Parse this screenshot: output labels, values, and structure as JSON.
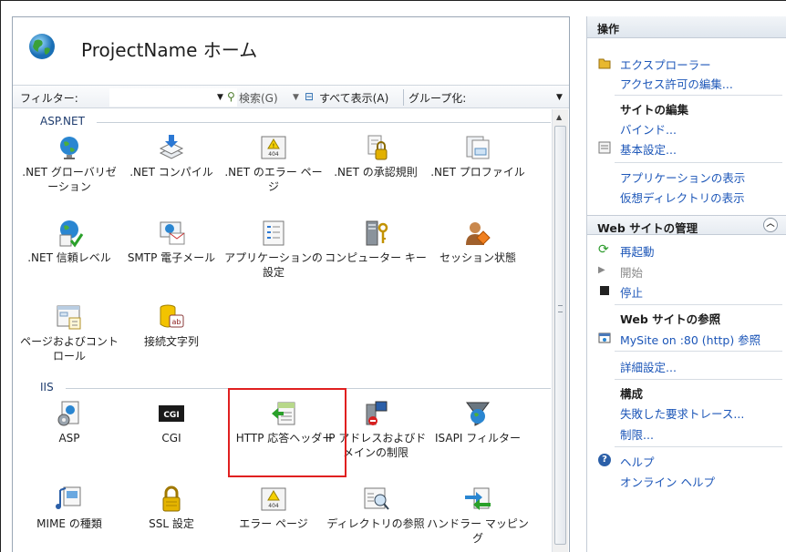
{
  "page": {
    "title": "ProjectName ホーム"
  },
  "toolbar": {
    "filter_label": "フィルター:",
    "filter_value": "",
    "search_label": "検索(G)",
    "show_all_label": "すべて表示(A)",
    "group_by_label": "グループ化:"
  },
  "groups": {
    "aspnet": "ASP.NET",
    "iis": "IIS"
  },
  "features": {
    "net_globalization": ".NET グローバリゼーション",
    "net_compilation": ".NET コンパイル",
    "net_error_pages": ".NET のエラー ページ",
    "net_authorization": ".NET の承認規則",
    "net_profile": ".NET プロファイル",
    "net_trust_level": ".NET 信頼レベル",
    "smtp_email": "SMTP 電子メール",
    "app_settings": "アプリケーションの設定",
    "machine_key": "コンピューター キー",
    "session_state": "セッション状態",
    "pages_controls": "ページおよびコントロール",
    "connection_strings": "接続文字列",
    "asp": "ASP",
    "cgi": "CGI",
    "http_response_headers": "HTTP 応答ヘッダー",
    "ip_domain_restrictions": "IP アドレスおよびドメインの制限",
    "isapi_filters": "ISAPI フィルター",
    "mime_types": "MIME の種類",
    "ssl_settings": "SSL 設定",
    "error_pages": "エラー ページ",
    "directory_browsing": "ディレクトリの参照",
    "handler_mappings": "ハンドラー マッピング"
  },
  "icon_text": {
    "cgi": "CGI",
    "error_code": "404"
  },
  "actions": {
    "title": "操作",
    "explore": "エクスプローラー",
    "edit_permissions": "アクセス許可の編集...",
    "edit_site_header": "サイトの編集",
    "bindings": "バインド...",
    "basic_settings": "基本設定...",
    "view_applications": "アプリケーションの表示",
    "view_virtual_dirs": "仮想ディレクトリの表示",
    "manage_website_header": "Web サイトの管理",
    "restart": "再起動",
    "start": "開始",
    "stop": "停止",
    "browse_website_header": "Web サイトの参照",
    "browse_link": "MySite on :80 (http) 参照",
    "advanced_settings": "詳細設定...",
    "configure_header": "構成",
    "failed_request_tracing": "失敗した要求トレース...",
    "limits": "制限...",
    "help": "ヘルプ",
    "online_help": "オンライン ヘルプ"
  },
  "colors": {
    "link": "#1c56b8",
    "highlight": "#e02020",
    "group_header": "#1e3c6e"
  }
}
